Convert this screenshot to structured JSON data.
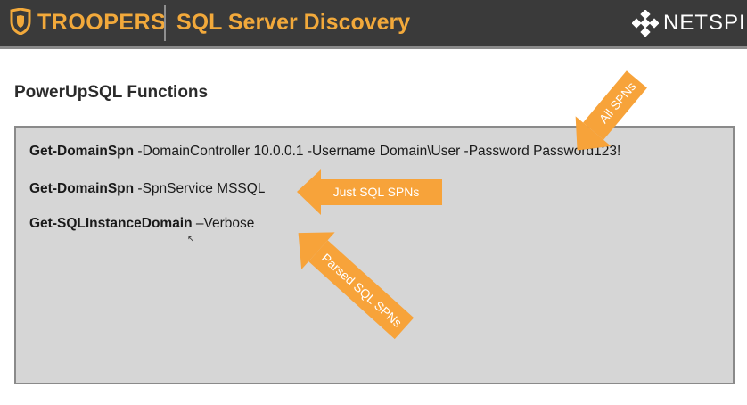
{
  "header": {
    "brand": "TROOPERS",
    "title": "SQL Server Discovery",
    "company": "NETSPI",
    "brand_color": "#f2a93b",
    "background_color": "#3a3a3a"
  },
  "slide": {
    "heading": "PowerUpSQL Functions",
    "commands": [
      {
        "name": "Get-DomainSpn",
        "args": " -DomainController 10.0.0.1  -Username Domain\\User -Password Password123!"
      },
      {
        "name": "Get-DomainSpn",
        "args": " -SpnService MSSQL"
      },
      {
        "name": "Get-SQLInstanceDomain",
        "args": " –Verbose"
      }
    ],
    "callouts": {
      "all_spns": "All SPNs",
      "just_sql_spns": "Just SQL SPNs",
      "parsed_sql_spns": "Parsed SQL SPNs"
    },
    "callout_color": "#f7a33a",
    "panel_color": "#d6d6d6"
  }
}
